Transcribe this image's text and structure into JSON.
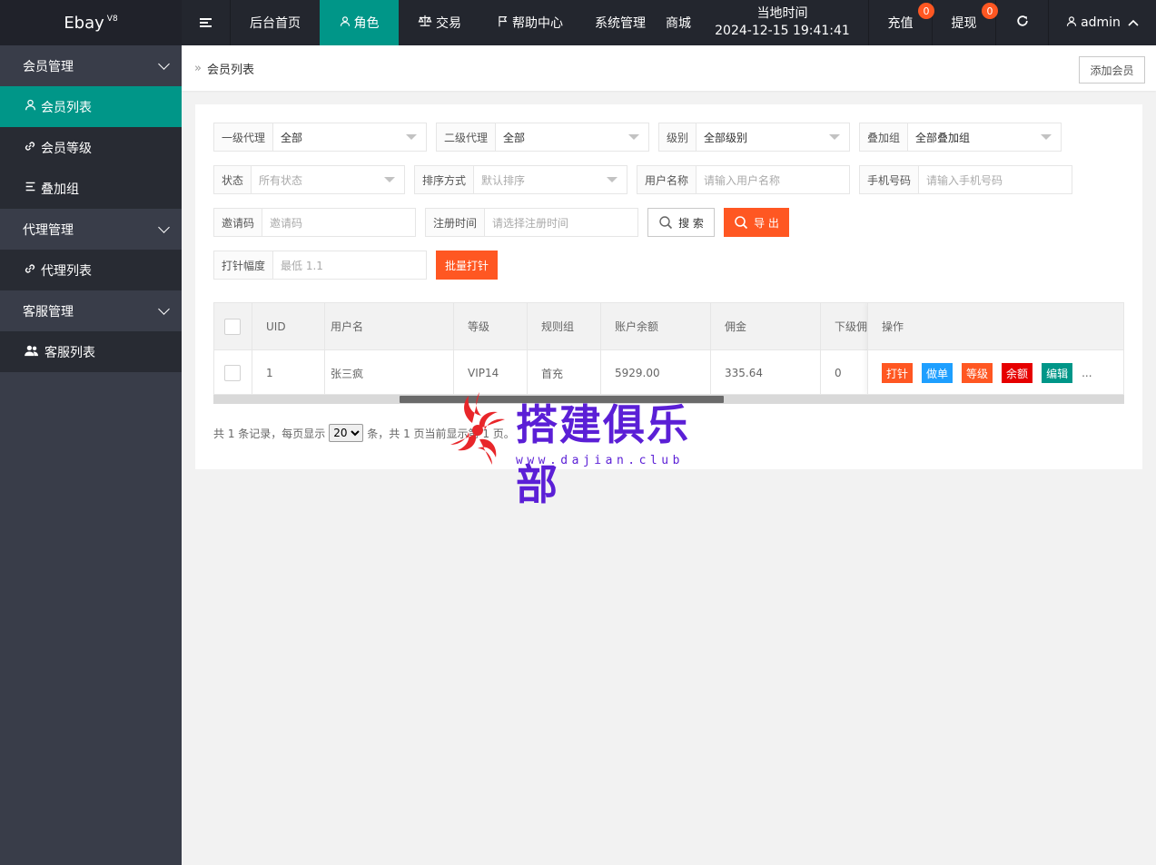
{
  "app": {
    "name": "Ebay",
    "version": "V8"
  },
  "sidebar": {
    "groups": [
      {
        "label": "会员管理",
        "items": [
          {
            "label": "会员列表",
            "icon": "user-icon",
            "active": true
          },
          {
            "label": "会员等级",
            "icon": "link-icon"
          },
          {
            "label": "叠加组",
            "icon": "list-icon"
          }
        ]
      },
      {
        "label": "代理管理",
        "items": [
          {
            "label": "代理列表",
            "icon": "link-icon"
          }
        ]
      },
      {
        "label": "客服管理",
        "items": [
          {
            "label": "客服列表",
            "icon": "users-icon"
          }
        ]
      }
    ]
  },
  "header": {
    "menu_icon": "menu-toggle-icon",
    "nav": [
      {
        "label": "后台首页"
      },
      {
        "label": "角色",
        "icon": "user-icon",
        "active": true
      },
      {
        "label": "交易",
        "icon": "scale-icon"
      },
      {
        "label": "帮助中心",
        "icon": "flag-icon"
      },
      {
        "label": "系统管理"
      },
      {
        "label": "商城"
      }
    ],
    "clock_label": "当地时间",
    "clock_value": "2024-12-15 19:41:41",
    "recharge_label": "充值",
    "recharge_badge": "0",
    "withdraw_label": "提现",
    "withdraw_badge": "0",
    "refresh_icon": "refresh-icon",
    "user_name": "admin"
  },
  "breadcrumb": {
    "separator": "»",
    "title": "会员列表",
    "add_button": "添加会员"
  },
  "filters": {
    "agent1": {
      "label": "一级代理",
      "value": "全部"
    },
    "agent2": {
      "label": "二级代理",
      "value": "全部"
    },
    "level": {
      "label": "级别",
      "value": "全部级别"
    },
    "group": {
      "label": "叠加组",
      "value": "全部叠加组"
    },
    "status": {
      "label": "状态",
      "placeholder": "所有状态"
    },
    "sort": {
      "label": "排序方式",
      "placeholder": "默认排序"
    },
    "username": {
      "label": "用户名称",
      "placeholder": "请输入用户名称"
    },
    "phone": {
      "label": "手机号码",
      "placeholder": "请输入手机号码"
    },
    "invite": {
      "label": "邀请码",
      "placeholder": "邀请码"
    },
    "regtime": {
      "label": "注册时间",
      "placeholder": "请选择注册时间"
    },
    "search_button": "搜 索",
    "export_button": "导 出",
    "punch": {
      "label": "打针幅度",
      "placeholder": "最低 1.1"
    },
    "batch_button": "批量打针"
  },
  "table": {
    "columns": [
      "UID",
      "用户名",
      "等级",
      "规则组",
      "账户余额",
      "佣金",
      "下级佣",
      "操作"
    ],
    "rows": [
      {
        "uid": "1",
        "username": "张三疯",
        "level": "VIP14",
        "group": "首充",
        "balance": "5929.00",
        "commission": "335.64",
        "sub": "0"
      }
    ],
    "actions": [
      {
        "label": "打针",
        "color": "#ff5722"
      },
      {
        "label": "做单",
        "color": "#1e9fff"
      },
      {
        "label": "等级",
        "color": "#ff5722"
      },
      {
        "label": "余额",
        "color": "#e60000"
      },
      {
        "label": "编辑",
        "color": "#009688"
      }
    ],
    "more": "...",
    "scroll_position": 0.29
  },
  "pager": {
    "prefix": "共 1 条记录，每页显示",
    "page_size": "20",
    "suffix": "条，共 1 页当前显示第 1 页。"
  },
  "watermark": {
    "text": "搭建俱乐部",
    "url": "www.dajian.club",
    "color": "#5b1fd6",
    "logo_color": "#e8262a"
  },
  "colors": {
    "accent": "#009688",
    "orange": "#ff5722",
    "sidebar": "#393d49",
    "header": "#23262e"
  }
}
